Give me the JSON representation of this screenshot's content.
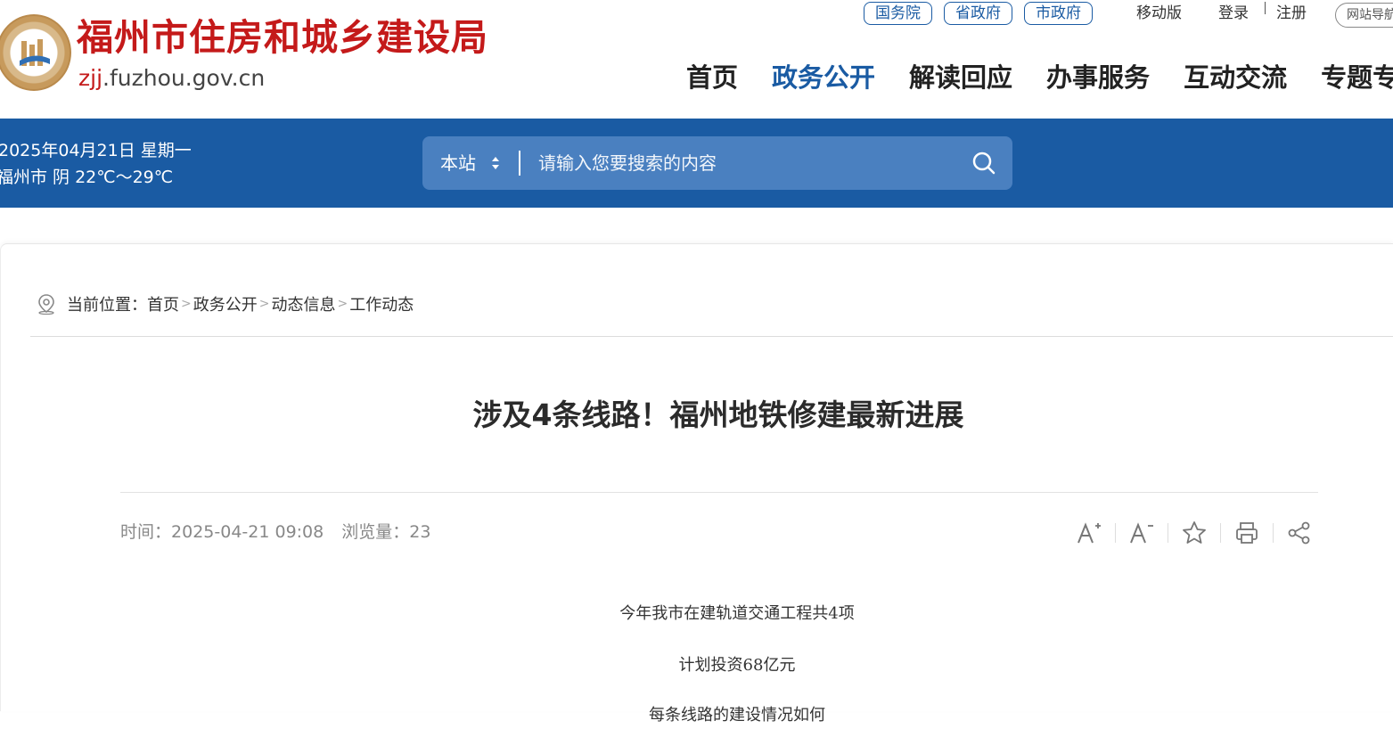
{
  "header": {
    "site_title": "福州市住房和城乡建设局",
    "domain_accent": "zjj",
    "domain_rest": ".fuzhou.gov.cn",
    "gov_links": [
      "国务院",
      "省政府",
      "市政府"
    ],
    "mobile_label": "移动版",
    "login_label": "登录",
    "register_label": "注册",
    "site_nav_label": "网站导航"
  },
  "nav": {
    "items": [
      "首页",
      "政务公开",
      "解读回应",
      "办事服务",
      "互动交流",
      "专题专栏"
    ],
    "active_index": 1
  },
  "info_bar": {
    "date": "2025年04月21日 星期一",
    "weather": "福州市 阴 22℃～29℃"
  },
  "search": {
    "scope": "本站",
    "placeholder": "请输入您要搜索的内容"
  },
  "breadcrumb": {
    "prefix": "当前位置：",
    "items": [
      "首页",
      "政务公开",
      "动态信息",
      "工作动态"
    ],
    "separator": ">"
  },
  "article": {
    "title": "涉及4条线路！福州地铁修建最新进展",
    "time_label": "时间：",
    "time_value": "2025-04-21 09:08",
    "views_label": "浏览量：",
    "views_value": "23",
    "paragraphs": [
      "今年我市在建轨道交通工程共4项",
      "计划投资68亿元",
      "每条线路的建设情况如何"
    ]
  },
  "tools": {
    "font_increase": "A+",
    "font_decrease": "A−"
  },
  "colors": {
    "brand_blue": "#1a5ba3",
    "search_bg": "#4a80c0",
    "title_red": "#c41a1a"
  }
}
